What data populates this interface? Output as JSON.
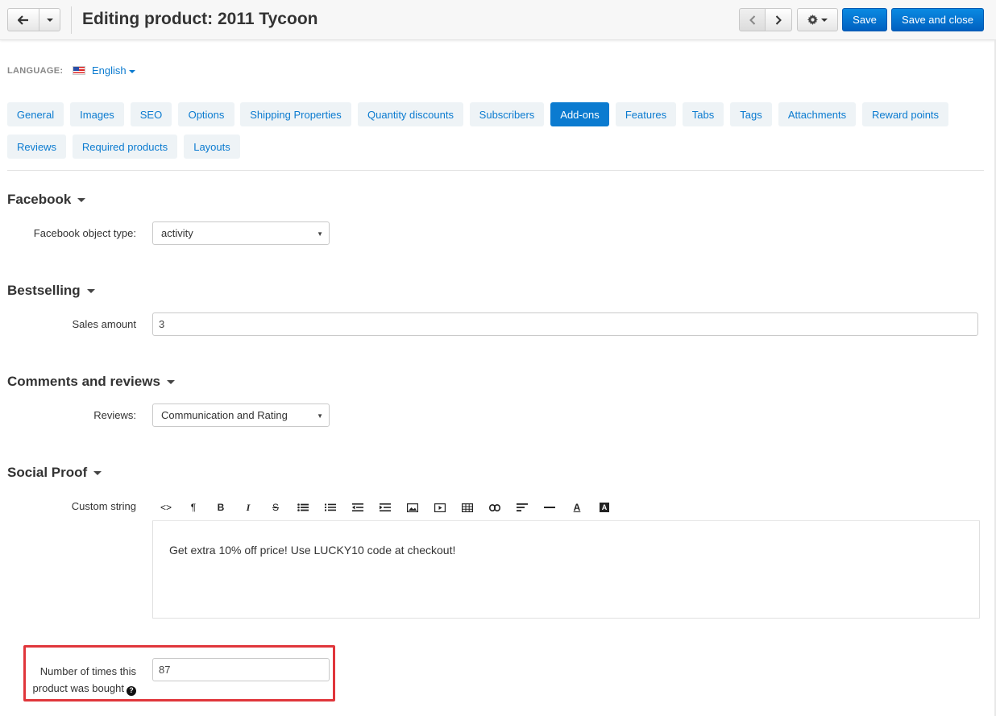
{
  "header": {
    "title": "Editing product: 2011 Tycoon",
    "save_label": "Save",
    "save_close_label": "Save and close"
  },
  "language": {
    "label": "LANGUAGE:",
    "value": "English"
  },
  "tabs": [
    {
      "label": "General"
    },
    {
      "label": "Images"
    },
    {
      "label": "SEO"
    },
    {
      "label": "Options"
    },
    {
      "label": "Shipping Properties"
    },
    {
      "label": "Quantity discounts"
    },
    {
      "label": "Subscribers"
    },
    {
      "label": "Add-ons",
      "active": true
    },
    {
      "label": "Features"
    },
    {
      "label": "Tabs"
    },
    {
      "label": "Tags"
    },
    {
      "label": "Attachments"
    },
    {
      "label": "Reward points"
    },
    {
      "label": "Reviews"
    },
    {
      "label": "Required products"
    },
    {
      "label": "Layouts"
    }
  ],
  "facebook": {
    "title": "Facebook",
    "object_type_label": "Facebook object type:",
    "object_type_value": "activity"
  },
  "bestselling": {
    "title": "Bestselling",
    "sales_amount_label": "Sales amount",
    "sales_amount_value": "3"
  },
  "comments": {
    "title": "Comments and reviews",
    "reviews_label": "Reviews:",
    "reviews_value": "Communication and Rating"
  },
  "social_proof": {
    "title": "Social Proof",
    "custom_string_label": "Custom string",
    "custom_string_value": "Get extra 10% off price! Use LUCKY10 code at checkout!",
    "times_bought_label_line1": "Number of times this",
    "times_bought_label_line2": "product was bought",
    "times_bought_value": "87"
  },
  "colors": {
    "primary": "#0b7bd0",
    "tab_bg": "#eef3f6",
    "highlight": "#e0363b"
  }
}
